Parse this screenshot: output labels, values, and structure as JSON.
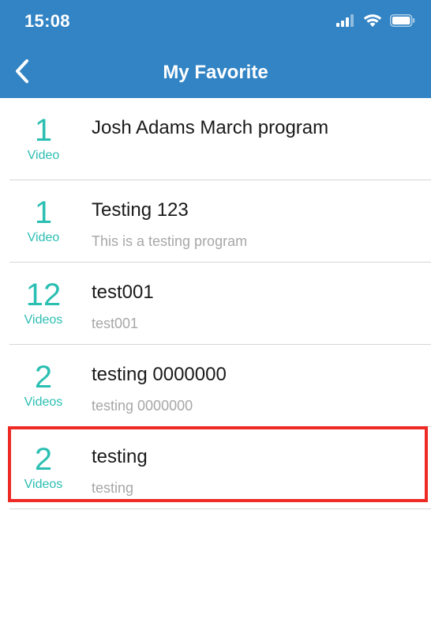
{
  "status_bar": {
    "time": "15:08",
    "icons": [
      "cellular-signal-icon",
      "wifi-icon",
      "battery-icon"
    ]
  },
  "nav": {
    "back_icon": "chevron-left-icon",
    "title": "My Favorite"
  },
  "colors": {
    "header": "#3284c4",
    "accent": "#2bbfb2",
    "highlight": "#ee2a24"
  },
  "favorites": [
    {
      "count": "1",
      "unit": "Video",
      "title": "Josh Adams March program",
      "subtitle": ""
    },
    {
      "count": "1",
      "unit": "Video",
      "title": "Testing 123",
      "subtitle": "This is a testing program"
    },
    {
      "count": "12",
      "unit": "Videos",
      "title": "test001",
      "subtitle": "test001"
    },
    {
      "count": "2",
      "unit": "Videos",
      "title": "testing 0000000",
      "subtitle": "testing 0000000"
    },
    {
      "count": "2",
      "unit": "Videos",
      "title": "testing",
      "subtitle": "testing"
    }
  ]
}
